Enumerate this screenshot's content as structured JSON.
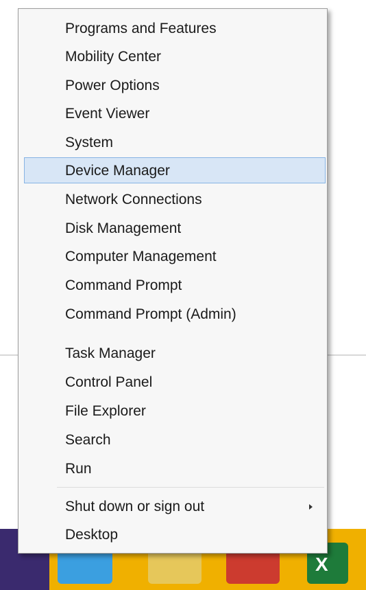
{
  "menu": {
    "items": [
      {
        "label": "Programs and Features"
      },
      {
        "label": "Mobility Center"
      },
      {
        "label": "Power Options"
      },
      {
        "label": "Event Viewer"
      },
      {
        "label": "System"
      },
      {
        "label": "Device Manager",
        "selected": true
      },
      {
        "label": "Network Connections"
      },
      {
        "label": "Disk Management"
      },
      {
        "label": "Computer Management"
      },
      {
        "label": "Command Prompt"
      },
      {
        "label": "Command Prompt (Admin)"
      },
      {
        "label": "Task Manager"
      },
      {
        "label": "Control Panel"
      },
      {
        "label": "File Explorer"
      },
      {
        "label": "Search"
      },
      {
        "label": "Run"
      },
      {
        "label": "Shut down or sign out",
        "has_submenu": true
      },
      {
        "label": "Desktop"
      }
    ]
  },
  "taskbar": {
    "excel_letter": "X"
  },
  "colors": {
    "menu_background": "#f7f7f7",
    "selection_fill": "#d8e6f6",
    "selection_border": "#86b3e4",
    "taskbar": "#f0b000"
  },
  "icons": {
    "submenu_arrow": "submenu-arrow-icon",
    "taskbar_apps": [
      "internet-explorer-icon",
      "file-explorer-icon",
      "chrome-icon",
      "excel-icon"
    ]
  }
}
